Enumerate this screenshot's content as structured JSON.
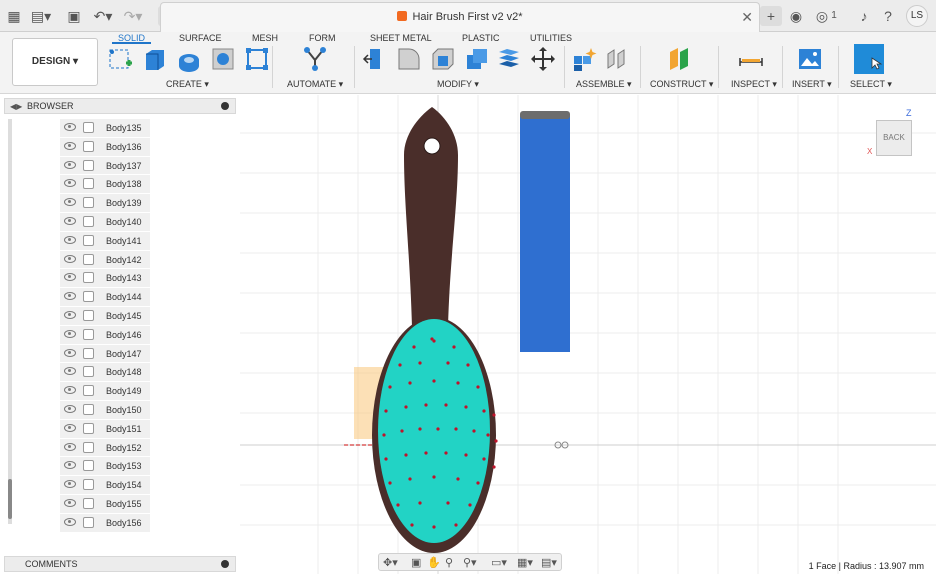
{
  "window": {
    "title": "Hair Brush First v2 v2*",
    "avatar_initials": "LS",
    "notification_count": "1"
  },
  "toolbar": {
    "workspace_label": "DESIGN ▾",
    "tabs": [
      "SOLID",
      "SURFACE",
      "MESH",
      "FORM",
      "SHEET METAL",
      "PLASTIC",
      "UTILITIES"
    ],
    "active_tab": "SOLID",
    "groups": [
      "CREATE ▾",
      "AUTOMATE ▾",
      "MODIFY ▾",
      "ASSEMBLE ▾",
      "CONSTRUCT ▾",
      "INSPECT ▾",
      "INSERT ▾",
      "SELECT ▾"
    ]
  },
  "browser": {
    "title": "BROWSER",
    "items": [
      "Body135",
      "Body136",
      "Body137",
      "Body138",
      "Body139",
      "Body140",
      "Body141",
      "Body142",
      "Body143",
      "Body144",
      "Body145",
      "Body146",
      "Body147",
      "Body148",
      "Body149",
      "Body150",
      "Body151",
      "Body152",
      "Body153",
      "Body154",
      "Body155",
      "Body156"
    ]
  },
  "comments": {
    "title": "COMMENTS"
  },
  "viewcube": {
    "face": "BACK",
    "axis_z": "Z",
    "axis_x": "X"
  },
  "status": {
    "text": "1 Face | Radius : 13.907 mm"
  },
  "colors": {
    "accent": "#1f75c9",
    "brush_handle": "#4a2e2a",
    "brush_pad": "#22d3c5",
    "pin": "#c0132b",
    "cylinder": "#2f6fd0"
  }
}
